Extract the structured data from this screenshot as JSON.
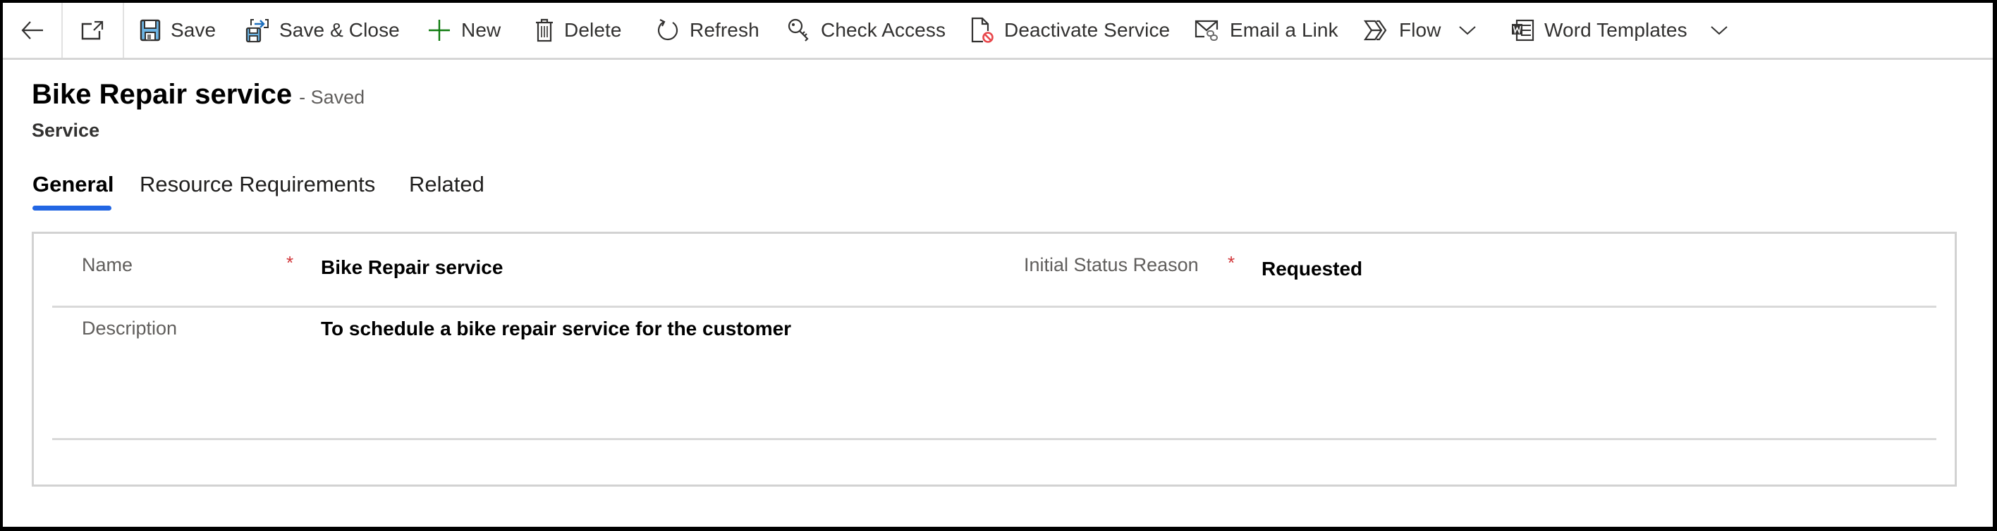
{
  "toolbar": {
    "nav": [
      {
        "name": "back-icon"
      },
      {
        "name": "open-in-new-window-icon"
      }
    ],
    "buttons": [
      {
        "id": "save",
        "label": "Save",
        "icon": "save-icon"
      },
      {
        "id": "save-close",
        "label": "Save & Close",
        "icon": "save-and-close-icon"
      },
      {
        "id": "new",
        "label": "New",
        "icon": "plus-icon"
      },
      {
        "id": "delete",
        "label": "Delete",
        "icon": "trash-icon"
      },
      {
        "id": "refresh",
        "label": "Refresh",
        "icon": "refresh-icon"
      },
      {
        "id": "check-access",
        "label": "Check Access",
        "icon": "key-search-icon"
      },
      {
        "id": "deactivate",
        "label": "Deactivate Service",
        "icon": "deactivate-document-icon"
      },
      {
        "id": "email-link",
        "label": "Email a Link",
        "icon": "email-link-icon"
      },
      {
        "id": "flow",
        "label": "Flow",
        "icon": "flow-icon",
        "has_dropdown": true
      },
      {
        "id": "word-templates",
        "label": "Word Templates",
        "icon": "word-icon",
        "has_dropdown": true
      }
    ]
  },
  "header": {
    "title": "Bike Repair service",
    "save_status": "- Saved",
    "entity": "Service"
  },
  "tabs": [
    {
      "label": "General",
      "active": true
    },
    {
      "label": "Resource Requirements",
      "active": false
    },
    {
      "label": "Related",
      "active": false
    }
  ],
  "form": {
    "fields": {
      "name": {
        "label": "Name",
        "required": true,
        "required_marker": "*",
        "value": "Bike Repair service"
      },
      "initial_status_reason": {
        "label": "Initial Status Reason",
        "required": true,
        "required_marker": "*",
        "value": "Requested"
      },
      "description": {
        "label": "Description",
        "required": false,
        "value": "To schedule a bike repair service for the customer"
      }
    }
  },
  "colors": {
    "accent": "#2266e3",
    "required": "#d13438",
    "new_icon": "#107c10",
    "save_icon_fill": "#6cb4e4",
    "deactivate_badge": "#e8474b"
  }
}
